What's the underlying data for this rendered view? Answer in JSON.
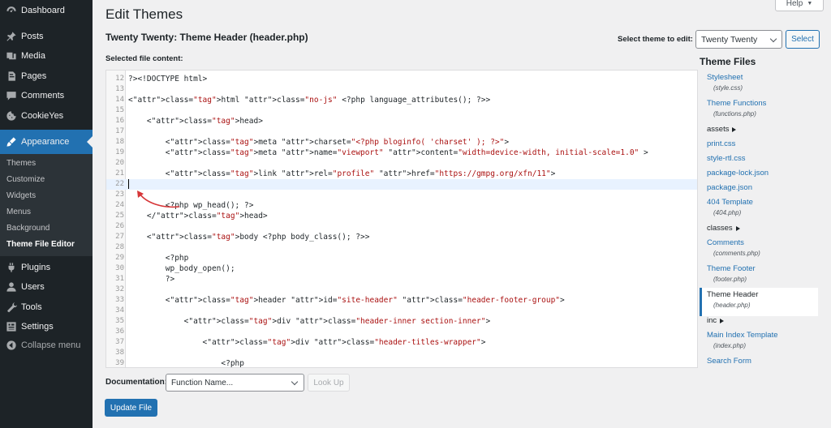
{
  "sidebar": {
    "items": [
      {
        "label": "Dashboard",
        "icon": "dashboard-icon"
      },
      {
        "label": "Posts",
        "icon": "pin-icon"
      },
      {
        "label": "Media",
        "icon": "media-icon"
      },
      {
        "label": "Pages",
        "icon": "page-icon"
      },
      {
        "label": "Comments",
        "icon": "comment-icon"
      },
      {
        "label": "CookieYes",
        "icon": "cookie-icon"
      },
      {
        "label": "Appearance",
        "icon": "brush-icon"
      },
      {
        "label": "Plugins",
        "icon": "plug-icon"
      },
      {
        "label": "Users",
        "icon": "user-icon"
      },
      {
        "label": "Tools",
        "icon": "wrench-icon"
      },
      {
        "label": "Settings",
        "icon": "settings-icon"
      },
      {
        "label": "Collapse menu",
        "icon": "collapse-icon"
      }
    ],
    "submenu": [
      "Themes",
      "Customize",
      "Widgets",
      "Menus",
      "Background",
      "Theme File Editor"
    ],
    "active_color": "#2271b1"
  },
  "header": {
    "title": "Edit Themes",
    "help": "Help",
    "file_title": "Twenty Twenty: Theme Header (header.php)",
    "select_label": "Select theme to edit:",
    "theme_value": "Twenty Twenty",
    "select_button": "Select",
    "content_label": "Selected file content:"
  },
  "editor": {
    "lines": [
      {
        "n": "12",
        "text": "?><!DOCTYPE html>"
      },
      {
        "n": "13",
        "text": ""
      },
      {
        "n": "14",
        "text": "<html class=\"no-js\" <?php language_attributes(); ?>>"
      },
      {
        "n": "15",
        "text": ""
      },
      {
        "n": "16",
        "text": "    <head>"
      },
      {
        "n": "17",
        "text": ""
      },
      {
        "n": "18",
        "text": "        <meta charset=\"<?php bloginfo( 'charset' ); ?>\">"
      },
      {
        "n": "19",
        "text": "        <meta name=\"viewport\" content=\"width=device-width, initial-scale=1.0\" >"
      },
      {
        "n": "20",
        "text": ""
      },
      {
        "n": "21",
        "text": "        <link rel=\"profile\" href=\"https://gmpg.org/xfn/11\">"
      },
      {
        "n": "22",
        "text": ""
      },
      {
        "n": "23",
        "text": ""
      },
      {
        "n": "24",
        "text": "        <?php wp_head(); ?>"
      },
      {
        "n": "25",
        "text": "    </head>"
      },
      {
        "n": "26",
        "text": ""
      },
      {
        "n": "27",
        "text": "    <body <?php body_class(); ?>>"
      },
      {
        "n": "28",
        "text": ""
      },
      {
        "n": "29",
        "text": "        <?php"
      },
      {
        "n": "30",
        "text": "        wp_body_open();"
      },
      {
        "n": "31",
        "text": "        ?>"
      },
      {
        "n": "32",
        "text": ""
      },
      {
        "n": "33",
        "text": "        <header id=\"site-header\" class=\"header-footer-group\">"
      },
      {
        "n": "34",
        "text": ""
      },
      {
        "n": "35",
        "text": "            <div class=\"header-inner section-inner\">"
      },
      {
        "n": "36",
        "text": ""
      },
      {
        "n": "37",
        "text": "                <div class=\"header-titles-wrapper\">"
      },
      {
        "n": "38",
        "text": ""
      },
      {
        "n": "39",
        "text": "                    <?php"
      }
    ],
    "current_line": "22"
  },
  "files": {
    "title": "Theme Files",
    "entries": [
      {
        "type": "file",
        "label": "Stylesheet",
        "sub": "(style.css)"
      },
      {
        "type": "file",
        "label": "Theme Functions",
        "sub": "(functions.php)"
      },
      {
        "type": "folder",
        "label": "assets"
      },
      {
        "type": "file",
        "label": "print.css"
      },
      {
        "type": "file",
        "label": "style-rtl.css"
      },
      {
        "type": "file",
        "label": "package-lock.json"
      },
      {
        "type": "file",
        "label": "package.json"
      },
      {
        "type": "file",
        "label": "404 Template",
        "sub": "(404.php)"
      },
      {
        "type": "folder",
        "label": "classes"
      },
      {
        "type": "file",
        "label": "Comments",
        "sub": "(comments.php)"
      },
      {
        "type": "file",
        "label": "Theme Footer",
        "sub": "(footer.php)"
      },
      {
        "type": "file",
        "label": "Theme Header",
        "sub": "(header.php)",
        "active": true
      },
      {
        "type": "folder",
        "label": "inc"
      },
      {
        "type": "file",
        "label": "Main Index Template",
        "sub": "(index.php)"
      },
      {
        "type": "file",
        "label": "Search Form"
      }
    ]
  },
  "footer": {
    "doc_label": "Documentation:",
    "doc_placeholder": "Function Name...",
    "lookup": "Look Up",
    "update": "Update File"
  }
}
